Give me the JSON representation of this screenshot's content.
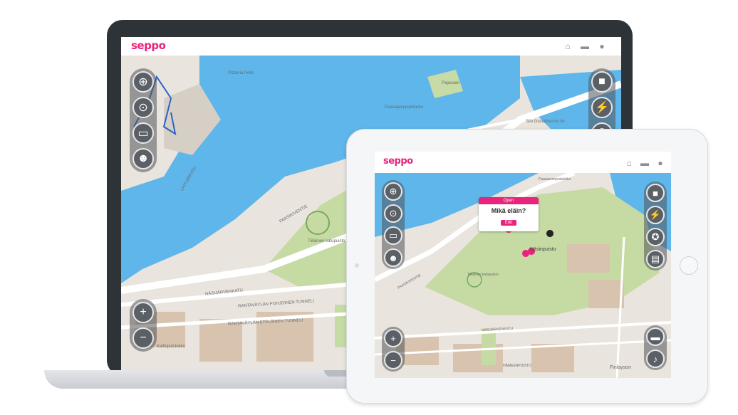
{
  "app": {
    "logo": "seppo",
    "accent": "#e8247c"
  },
  "top_icons": [
    "home-icon",
    "chat-icon",
    "user-icon"
  ],
  "laptop": {
    "left_toolbar": [
      "gamepad-icon",
      "add-location-icon",
      "map-book-icon",
      "user-settings-icon"
    ],
    "right_toolbar": [
      "stop-icon",
      "lightning-icon",
      "badge-icon"
    ],
    "zoom": {
      "in": "+",
      "out": "−"
    },
    "map_labels": {
      "street_1": "PAASIKIVENTIE",
      "street_2": "NÄSIJÄRVENKATU",
      "street_3": "RANTAVÄYLÄN POHJOINEN TUNNELI",
      "street_4": "RANTAVÄYLÄN ETELÄINEN TUNNELI",
      "street_5": "LAITURIKATU",
      "park": "Tiiliäinen katupuisto",
      "place_1": "Pizzeria Pelle",
      "place_2": "Pajasaari",
      "place_3": "Paasaarenpuistokko",
      "place_4": "Silo Gustafssonin tie",
      "place_5": "Kalliopuistokko"
    }
  },
  "tablet": {
    "left_toolbar": [
      "gamepad-icon",
      "add-location-icon",
      "map-book-icon",
      "user-settings-icon"
    ],
    "right_toolbar": [
      "stop-icon",
      "lightning-icon",
      "badge-icon",
      "briefcase-icon"
    ],
    "bottom_right_toolbar": [
      "chat-icon",
      "bell-icon"
    ],
    "zoom": {
      "in": "+",
      "out": "−"
    },
    "popup": {
      "status": "Open",
      "question": "Mikä eläin?",
      "edit": "Edit"
    },
    "map_labels": {
      "park": "Näsinpuisto",
      "park_2": "Tiiliäinen katupuisto",
      "street_1": "PAASIKIVENTIE",
      "street_2": "NÄSIJÄRVENKATU",
      "street_3": "HÄMEENPUISTO",
      "place_1": "Finlayson",
      "place_2": "Paasaarenpuistokko"
    }
  }
}
